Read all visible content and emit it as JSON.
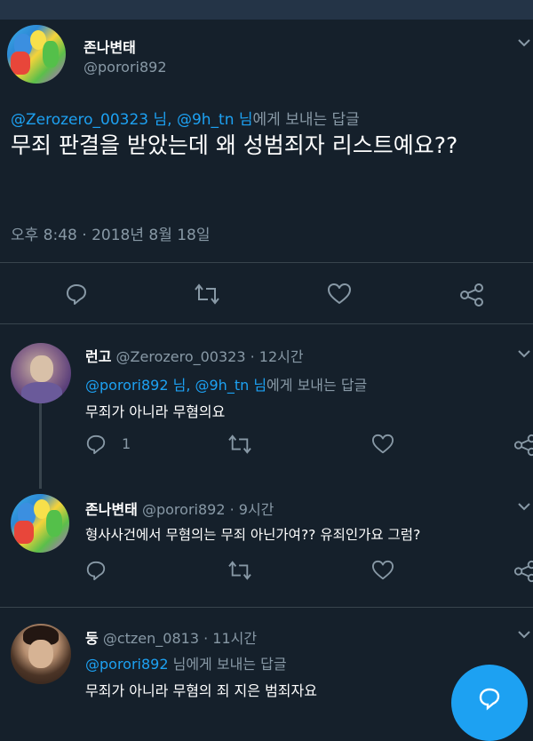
{
  "main_tweet": {
    "display_name": "존나변태",
    "handle": "@porori892",
    "reply_to_prefix": "@Zerozero_00323 님, @9h_tn 님",
    "reply_to_suffix": "에게 보내는 답글",
    "text": "무죄 판결을 받았는데 왜 성범죄자 리스트예요??",
    "timestamp": "오후 8:48 · 2018년 8월 18일"
  },
  "replies": [
    {
      "display_name": "런고",
      "handle": "@Zerozero_00323",
      "time": "· 12시간",
      "reply_to_prefix": "@porori892 님, @9h_tn 님",
      "reply_to_suffix": "에게 보내는 답글",
      "text": "무죄가 아니라 무혐의요",
      "reply_count": "1"
    },
    {
      "display_name": "존나변태",
      "handle": "@porori892",
      "time": "· 9시간",
      "text": "형사사건에서 무혐의는 무죄 아닌가여?? 유죄인가요 그럼?"
    },
    {
      "display_name": "둥",
      "handle": "@ctzen_0813",
      "time": "· 11시간",
      "reply_to_prefix": "@porori892",
      "reply_to_suffix": " 님에게 보내는 답글",
      "text": "무죄가 아니라 무혐의 죄 지은 범죄자요"
    }
  ],
  "colors": {
    "background": "#15202b",
    "accent": "#1da1f2",
    "muted": "#8899a6",
    "divider": "#38444d"
  },
  "icons": [
    "reply-icon",
    "retweet-icon",
    "like-icon",
    "share-icon",
    "chevron-down-icon",
    "compose-icon"
  ]
}
